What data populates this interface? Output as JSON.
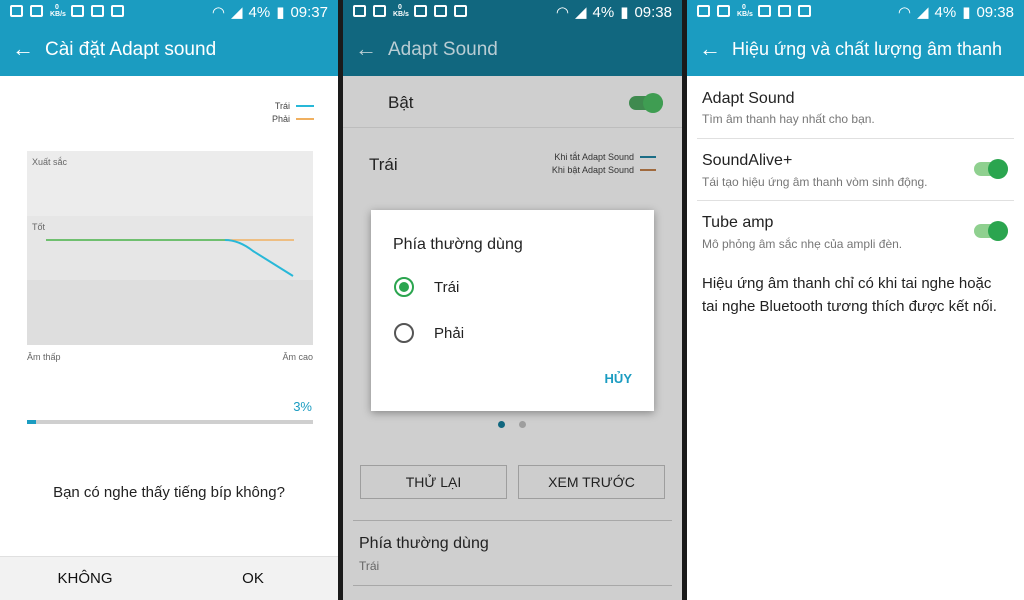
{
  "screen1": {
    "status": {
      "kb_top": "0",
      "kb_bottom": "KB/s",
      "battery": "4%",
      "time": "09:37"
    },
    "title": "Cài đặt Adapt sound",
    "legend": {
      "left": "Trái",
      "right": "Phải",
      "left_color": "#28b8d8",
      "right_color": "#f0b060"
    },
    "graph": {
      "level_top": "Xuất sắc",
      "level_mid": "Tốt",
      "x_low": "Âm thấp",
      "x_high": "Âm cao"
    },
    "progress": {
      "label": "3%",
      "value": 0.03
    },
    "question": "Bạn có nghe thấy tiếng bíp không?",
    "buttons": {
      "no": "KHÔNG",
      "ok": "OK"
    }
  },
  "screen2": {
    "status": {
      "kb_top": "0",
      "kb_bottom": "KB/s",
      "battery": "4%",
      "time": "09:38"
    },
    "title": "Adapt Sound",
    "on_label": "Bật",
    "channel_label": "Trái",
    "legend": {
      "off": "Khi tắt Adapt Sound",
      "on": "Khi bật Adapt Sound",
      "off_color": "#1b9cc1",
      "on_color": "#e08a3c"
    },
    "dialog": {
      "title": "Phía thường dùng",
      "options": [
        "Trái",
        "Phải"
      ],
      "cancel": "HỦY"
    },
    "buttons": {
      "retry": "THỬ LẠI",
      "preview": "XEM TRƯỚC"
    },
    "side": {
      "title": "Phía thường dùng",
      "value": "Trái"
    }
  },
  "screen3": {
    "status": {
      "kb_top": "0",
      "kb_bottom": "KB/s",
      "battery": "4%",
      "time": "09:38"
    },
    "title": "Hiệu ứng và chất lượng âm thanh",
    "items": [
      {
        "title": "Adapt Sound",
        "subtitle": "Tìm âm thanh hay nhất cho bạn."
      },
      {
        "title": "SoundAlive+",
        "subtitle": "Tái tạo hiệu ứng âm thanh vòm sinh động."
      },
      {
        "title": "Tube amp",
        "subtitle": "Mô phỏng âm sắc nhẹ của ampli đèn."
      }
    ],
    "note": "Hiệu ứng âm thanh chỉ có khi tai nghe hoặc tai nghe Bluetooth tương thích được kết nối."
  },
  "colors": {
    "accent": "#1b9cc1",
    "accent_dark": "#11677f",
    "switch_on": "#2ba54f",
    "graph_green": "#6fbf6f"
  }
}
